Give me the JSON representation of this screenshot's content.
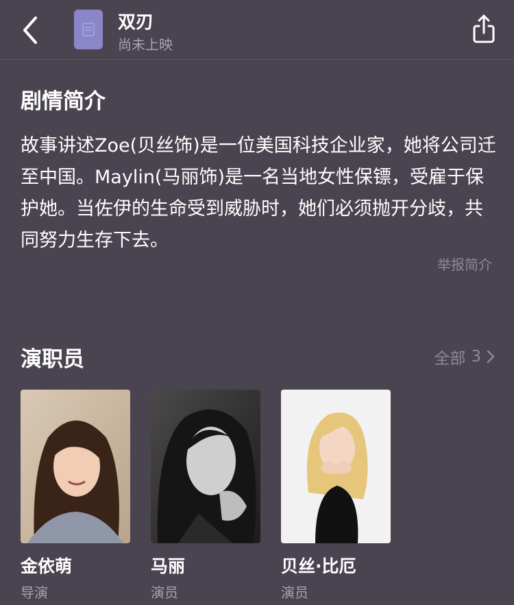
{
  "header": {
    "title": "双刃",
    "status": "尚未上映"
  },
  "synopsis": {
    "heading": "剧情简介",
    "text": "故事讲述Zoe(贝丝饰)是一位美国科技企业家，她将公司迁至中国。Maylin(马丽饰)是一名当地女性保镖，受雇于保护她。当佐伊的生命受到威胁时，她们必须抛开分歧，共同努力生存下去。",
    "report_label": "举报简介"
  },
  "cast": {
    "heading": "演职员",
    "all_label": "全部",
    "all_count": "3",
    "members": [
      {
        "name": "金依萌",
        "role": "导演"
      },
      {
        "name": "马丽",
        "role": "演员"
      },
      {
        "name": "贝丝·比厄",
        "role": "演员"
      }
    ]
  },
  "colors": {
    "background": "#4a4450",
    "poster_placeholder": "#8a86c8",
    "secondary_text": "#a8a3ad",
    "muted_text": "#8d8893"
  },
  "icons": [
    "back-arrow-icon",
    "poster-placeholder-icon",
    "share-icon",
    "chevron-right-icon"
  ]
}
